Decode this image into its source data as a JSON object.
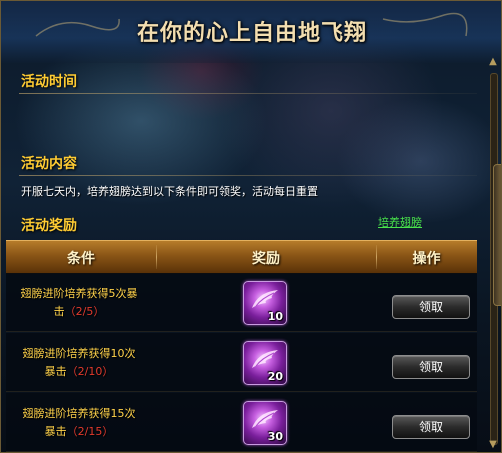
{
  "title": "在你的心上自由地飞翔",
  "sections": {
    "time_label": "活动时间",
    "content_label": "活动内容",
    "content_text": "开服七天内，培养翅膀达到以下条件即可领奖，活动每日重置",
    "reward_label": "活动奖励",
    "link_label": "培养翅膀"
  },
  "table": {
    "headers": {
      "condition": "条件",
      "reward": "奖励",
      "action": "操作"
    },
    "rows": [
      {
        "condition_line1": "翅膀进阶培养获得5次暴",
        "condition_line2": "击",
        "progress": "（2/5）",
        "reward_qty": "10",
        "button": "领取"
      },
      {
        "condition_line1": "翅膀进阶培养获得10次",
        "condition_line2": "暴击",
        "progress": "（2/10）",
        "reward_qty": "20",
        "button": "领取"
      },
      {
        "condition_line1": "翅膀进阶培养获得15次",
        "condition_line2": "暴击",
        "progress": "（2/15）",
        "reward_qty": "30",
        "button": "领取"
      }
    ]
  },
  "icons": {
    "reward_item": "wing-feather-icon",
    "scroll_up": "scroll-up-arrow-icon",
    "scroll_down": "scroll-down-arrow-icon"
  },
  "colors": {
    "section_label": "#ffcc33",
    "condition_text": "#ffd24a",
    "progress": "#e13a2d",
    "link": "#49e34b",
    "header_bar": "#8a5516"
  }
}
